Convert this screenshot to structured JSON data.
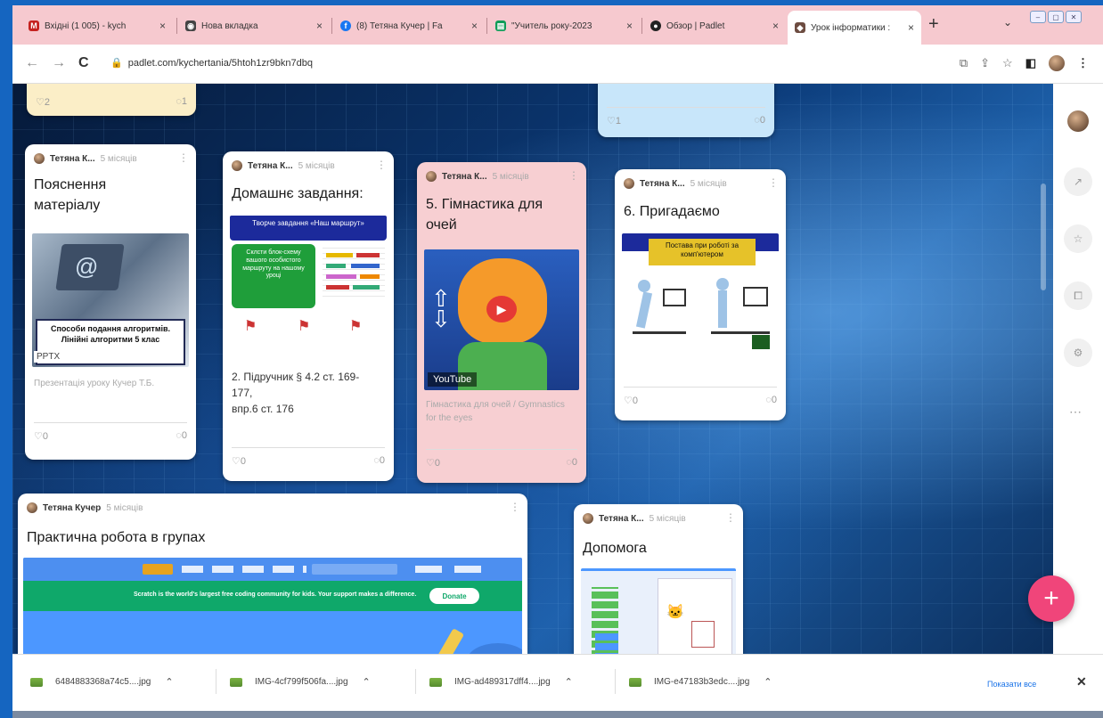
{
  "tabs": [
    {
      "title": "Вхідні (1 005) - kych",
      "favicon_color": "#c5221f",
      "favicon": "M"
    },
    {
      "title": "Нова вкладка",
      "favicon_color": "#444444",
      "favicon": "◉"
    },
    {
      "title": "(8) Тетяна Кучер | Fa",
      "favicon_color": "#1877f2",
      "favicon": "f"
    },
    {
      "title": "\"Учитель року-2023",
      "favicon_color": "#0f9d58",
      "favicon": "▤"
    },
    {
      "title": "Обзор | Padlet",
      "favicon_color": "#222222",
      "favicon": "●"
    },
    {
      "title": "Урок інформатики :",
      "favicon_color": "#6d4c41",
      "favicon": "◆"
    }
  ],
  "address": {
    "url": "padlet.com/kychertania/5htoh1zr9bkn7dbq"
  },
  "cards": {
    "top_left": {
      "likes": "♡2",
      "comments": "◌1"
    },
    "top_right": {
      "likes": "♡1",
      "comments": "◌0"
    },
    "c1": {
      "author": "Тетяна К...",
      "time": "5 місяців",
      "title_1": "Пояснення",
      "title_2": "матеріалу",
      "img_caption": "Способи подання алгоритмів. Лінійні алгоритми 5 клас",
      "img_tag": "PPTX",
      "sub": "Презентація уроку Кучер Т.Б.",
      "likes": "♡0",
      "comments": "◌0"
    },
    "c2": {
      "author": "Тетяна К...",
      "time": "5 місяців",
      "title": "Домашнє завдання:",
      "img_header": "Творче завдання «Наш маршрут»",
      "img_green": "Склсти блок-схему вашого особистого маршруту на нашому уроці",
      "text_1": "2. Підручник § 4.2 ст. 169-",
      "text_2": "177,",
      "text_3": "впр.6 ст. 176",
      "likes": "♡0",
      "comments": "◌0"
    },
    "c3": {
      "author": "Тетяна К...",
      "time": "5 місяців",
      "title_1": "5. Гімнастика для",
      "title_2": "очей",
      "yt_label": "YouTube",
      "sub": "Гімнастика для очей / Gymnastics for the eyes",
      "likes": "♡0",
      "comments": "◌0"
    },
    "c4": {
      "author": "Тетяна К...",
      "time": "5 місяців",
      "title": "6. Пригадаємо",
      "img_banner": "Постава при роботі за комп'ютером",
      "likes": "♡0",
      "comments": "◌0"
    },
    "c5": {
      "author": "Тетяна Кучер",
      "time": "5 місяців",
      "title": "Практична робота в групах",
      "banner": "Scratch is the world's largest free coding community for kids. Your support makes a difference.",
      "donate": "Donate"
    },
    "c6": {
      "author": "Тетяна К...",
      "time": "5 місяців",
      "title": "Допомога"
    }
  },
  "downloads": [
    {
      "name": "6484883368a74c5....jpg"
    },
    {
      "name": "IMG-4cf799f506fa....jpg"
    },
    {
      "name": "IMG-ad489317dff4....jpg"
    },
    {
      "name": "IMG-e47183b3edc....jpg"
    }
  ],
  "downloads_show_all": "Показати все",
  "fab_label": "+"
}
